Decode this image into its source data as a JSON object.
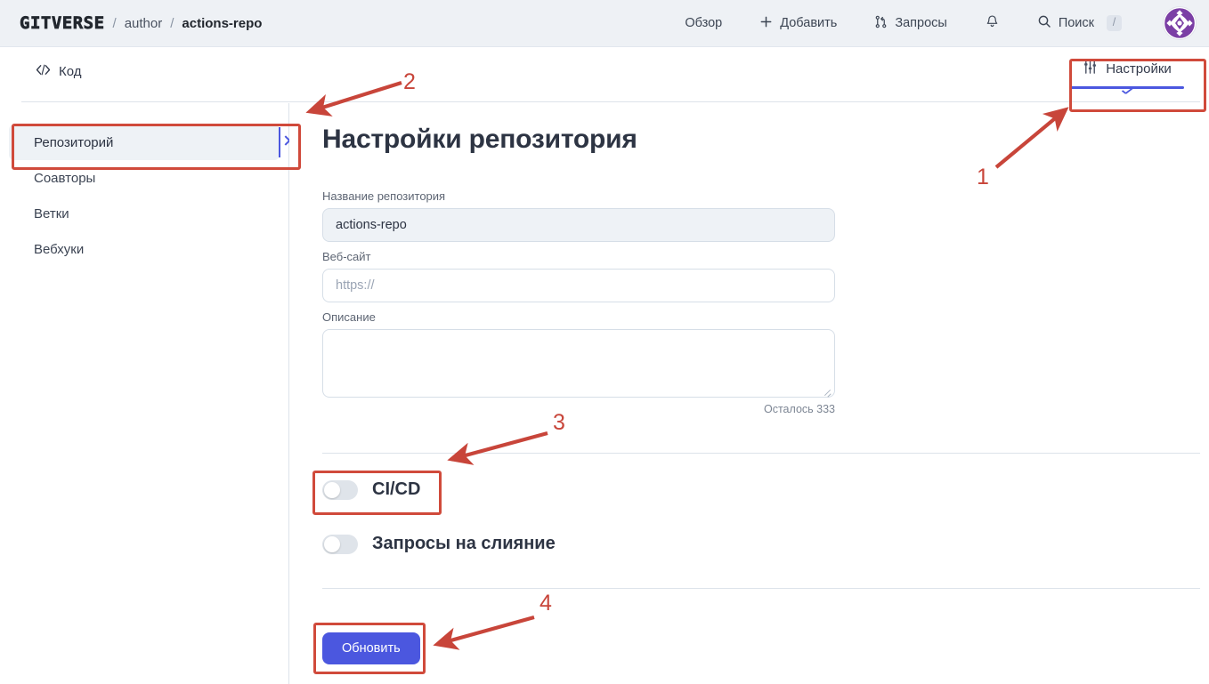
{
  "header": {
    "logo": "GITVERSE",
    "separator": "/",
    "owner": "author",
    "repo": "actions-repo",
    "nav": [
      {
        "label": "Обзор",
        "icon": "none"
      },
      {
        "label": "Добавить",
        "icon": "plus-icon"
      },
      {
        "label": "Запросы",
        "icon": "pull-request-icon"
      },
      {
        "label": "",
        "icon": "bell-icon"
      },
      {
        "label": "Поиск",
        "icon": "search-icon",
        "shortcut": "/"
      }
    ],
    "avatar_alt": "user-avatar"
  },
  "tabs": {
    "code": {
      "label": "Код",
      "icon": "code-icon"
    },
    "settings": {
      "label": "Настройки",
      "icon": "sliders-icon",
      "active": true
    }
  },
  "sidebar": {
    "items": [
      {
        "label": "Репозиторий",
        "active": true
      },
      {
        "label": "Соавторы",
        "active": false
      },
      {
        "label": "Ветки",
        "active": false
      },
      {
        "label": "Вебхуки",
        "active": false
      }
    ]
  },
  "main": {
    "title": "Настройки репозитория",
    "fields": {
      "name": {
        "label": "Название репозитория",
        "value": "actions-repo",
        "placeholder": ""
      },
      "website": {
        "label": "Веб-сайт",
        "value": "",
        "placeholder": "https://"
      },
      "description": {
        "label": "Описание",
        "value": "",
        "placeholder": ""
      }
    },
    "chars_left": "Осталось 333",
    "toggles": [
      {
        "label": "CI/CD",
        "on": false
      },
      {
        "label": "Запросы на слияние",
        "on": false
      }
    ],
    "submit_label": "Обновить"
  },
  "annotations": {
    "numbers": [
      "1",
      "2",
      "3",
      "4"
    ],
    "accent_color": "#c8453a"
  },
  "colors": {
    "brand_blue": "#4b57df",
    "header_bg": "#eef1f5",
    "text_dark": "#2d3443",
    "annotation_red": "#c8453a"
  }
}
